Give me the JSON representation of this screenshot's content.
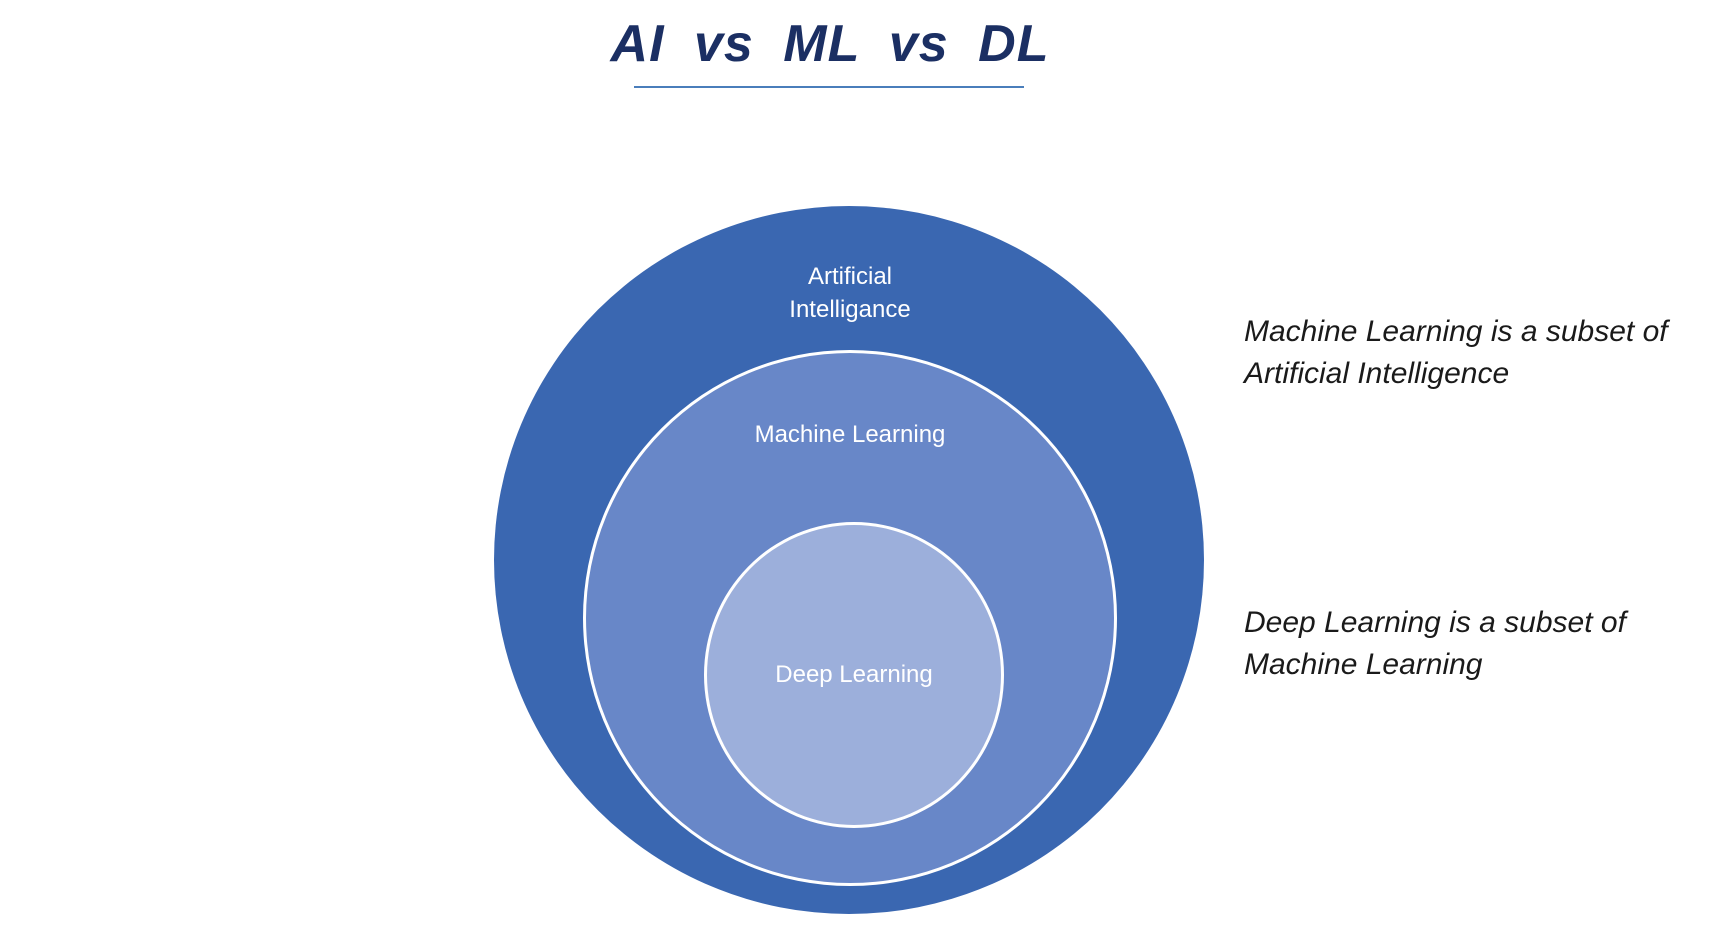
{
  "title": "AI  vs  ML  vs  DL",
  "diagram": {
    "outer": {
      "label_line1": "Artificial",
      "label_line2": "Intelligance"
    },
    "middle": {
      "label": "Machine Learning"
    },
    "inner": {
      "label": "Deep Learning"
    }
  },
  "notes": {
    "ml": {
      "line1": "Machine Learning is a subset of",
      "line2": "Artificial Intelligence"
    },
    "dl": {
      "line1": "Deep Learning is a subset of",
      "line2": "Machine Learning"
    }
  },
  "colors": {
    "title": "#1b2f63",
    "outer_circle": "#3a67b1",
    "middle_circle": "#6887c8",
    "inner_circle": "#9cafdb"
  }
}
